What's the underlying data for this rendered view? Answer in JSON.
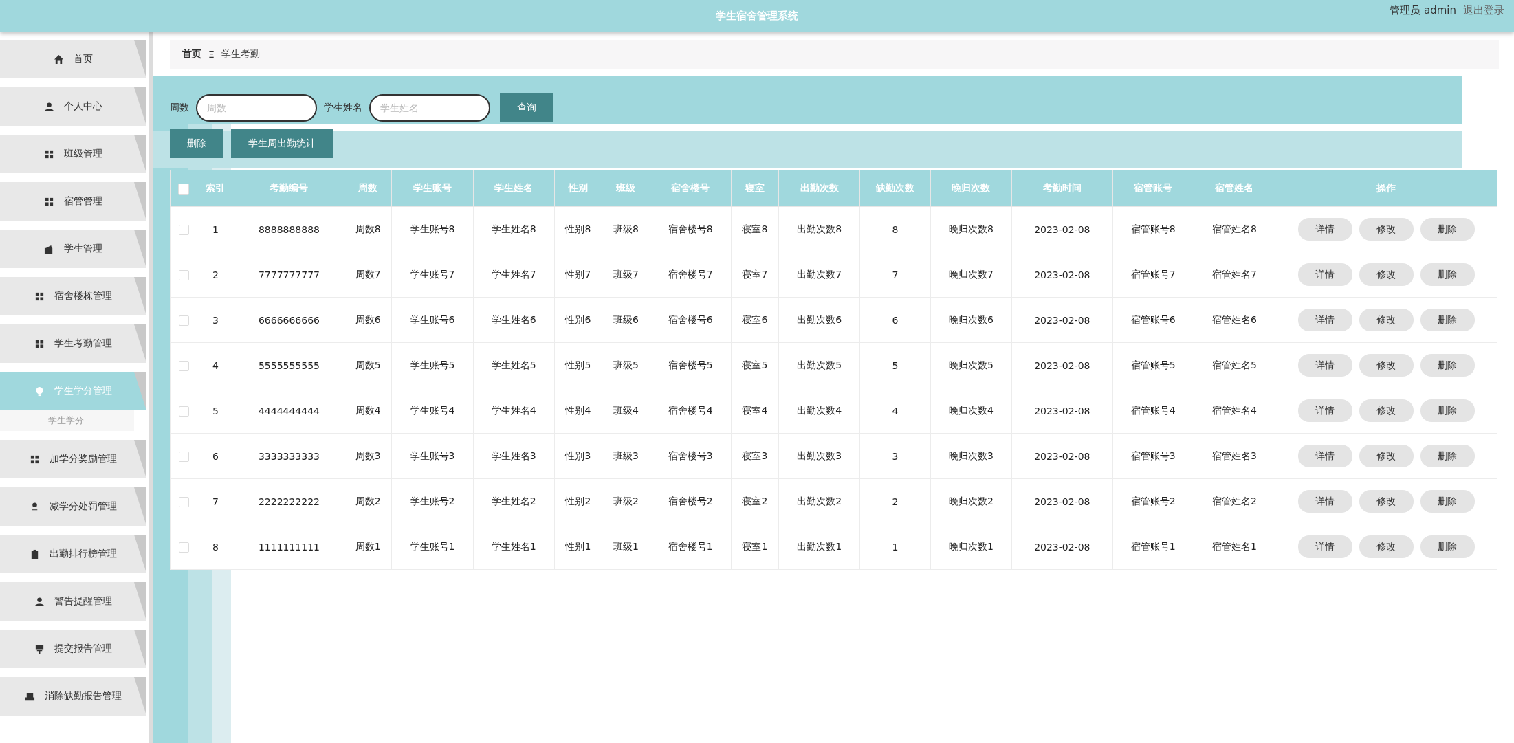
{
  "header": {
    "title": "学生宿舍管理系统",
    "user": "管理员 admin",
    "logout": "退出登录"
  },
  "sidebar": {
    "items": [
      {
        "label": "首页",
        "selected": false
      },
      {
        "label": "个人中心",
        "selected": false
      },
      {
        "label": "班级管理",
        "selected": false
      },
      {
        "label": "宿管管理",
        "selected": false
      },
      {
        "label": "学生管理",
        "selected": false
      },
      {
        "label": "宿舍楼栋管理",
        "selected": false
      },
      {
        "label": "学生考勤管理",
        "selected": false
      },
      {
        "label": "学生学分管理",
        "selected": true,
        "children": [
          {
            "label": "学生学分"
          }
        ]
      },
      {
        "label": "加学分奖励管理",
        "selected": false
      },
      {
        "label": "减学分处罚管理",
        "selected": false
      },
      {
        "label": "出勤排行榜管理",
        "selected": false
      },
      {
        "label": "警告提醒管理",
        "selected": false
      },
      {
        "label": "提交报告管理",
        "selected": false
      },
      {
        "label": "消除缺勤报告管理",
        "selected": false
      }
    ]
  },
  "breadcrumb": [
    "首页",
    "Ξ",
    "学生考勤"
  ],
  "search": {
    "fields": [
      {
        "label": "周数",
        "placeholder": "周数"
      },
      {
        "label": "学生姓名",
        "placeholder": "学生姓名"
      }
    ],
    "button": "查询"
  },
  "actions": [
    "删除",
    "学生周出勤统计"
  ],
  "table": {
    "select_all": false,
    "columns": [
      "索引",
      "考勤编号",
      "周数",
      "学生账号",
      "学生姓名",
      "性别",
      "班级",
      "宿舍楼号",
      "寝室",
      "出勤次数",
      "缺勤次数",
      "晚归次数",
      "考勤时间",
      "宿管账号",
      "宿管姓名",
      "操作"
    ],
    "rows": [
      {
        "checked": false,
        "cells": [
          "1",
          "8888888888",
          "周数8",
          "学生账号8",
          "学生姓名8",
          "性别8",
          "班级8",
          "宿舍楼号8",
          "寝室8",
          "出勤次数8",
          "8",
          "晚归次数8",
          "2023-02-08",
          "宿管账号8",
          "宿管姓名8"
        ],
        "buttons": [
          "详情",
          "修改",
          "删除"
        ]
      },
      {
        "checked": false,
        "cells": [
          "2",
          "7777777777",
          "周数7",
          "学生账号7",
          "学生姓名7",
          "性别7",
          "班级7",
          "宿舍楼号7",
          "寝室7",
          "出勤次数7",
          "7",
          "晚归次数7",
          "2023-02-08",
          "宿管账号7",
          "宿管姓名7"
        ],
        "buttons": [
          "详情",
          "修改",
          "删除"
        ]
      },
      {
        "checked": false,
        "cells": [
          "3",
          "6666666666",
          "周数6",
          "学生账号6",
          "学生姓名6",
          "性别6",
          "班级6",
          "宿舍楼号6",
          "寝室6",
          "出勤次数6",
          "6",
          "晚归次数6",
          "2023-02-08",
          "宿管账号6",
          "宿管姓名6"
        ],
        "buttons": [
          "详情",
          "修改",
          "删除"
        ]
      },
      {
        "checked": false,
        "cells": [
          "4",
          "5555555555",
          "周数5",
          "学生账号5",
          "学生姓名5",
          "性别5",
          "班级5",
          "宿舍楼号5",
          "寝室5",
          "出勤次数5",
          "5",
          "晚归次数5",
          "2023-02-08",
          "宿管账号5",
          "宿管姓名5"
        ],
        "buttons": [
          "详情",
          "修改",
          "删除"
        ]
      },
      {
        "checked": false,
        "cells": [
          "5",
          "4444444444",
          "周数4",
          "学生账号4",
          "学生姓名4",
          "性别4",
          "班级4",
          "宿舍楼号4",
          "寝室4",
          "出勤次数4",
          "4",
          "晚归次数4",
          "2023-02-08",
          "宿管账号4",
          "宿管姓名4"
        ],
        "buttons": [
          "详情",
          "修改",
          "删除"
        ]
      },
      {
        "checked": false,
        "cells": [
          "6",
          "3333333333",
          "周数3",
          "学生账号3",
          "学生姓名3",
          "性别3",
          "班级3",
          "宿舍楼号3",
          "寝室3",
          "出勤次数3",
          "3",
          "晚归次数3",
          "2023-02-08",
          "宿管账号3",
          "宿管姓名3"
        ],
        "buttons": [
          "详情",
          "修改",
          "删除"
        ]
      },
      {
        "checked": false,
        "cells": [
          "7",
          "2222222222",
          "周数2",
          "学生账号2",
          "学生姓名2",
          "性别2",
          "班级2",
          "宿舍楼号2",
          "寝室2",
          "出勤次数2",
          "2",
          "晚归次数2",
          "2023-02-08",
          "宿管账号2",
          "宿管姓名2"
        ],
        "buttons": [
          "详情",
          "修改",
          "删除"
        ]
      },
      {
        "checked": false,
        "cells": [
          "8",
          "1111111111",
          "周数1",
          "学生账号1",
          "学生姓名1",
          "性别1",
          "班级1",
          "宿舍楼号1",
          "寝室1",
          "出勤次数1",
          "1",
          "晚归次数1",
          "2023-02-08",
          "宿管账号1",
          "宿管姓名1"
        ],
        "buttons": [
          "详情",
          "修改",
          "删除"
        ]
      }
    ]
  }
}
